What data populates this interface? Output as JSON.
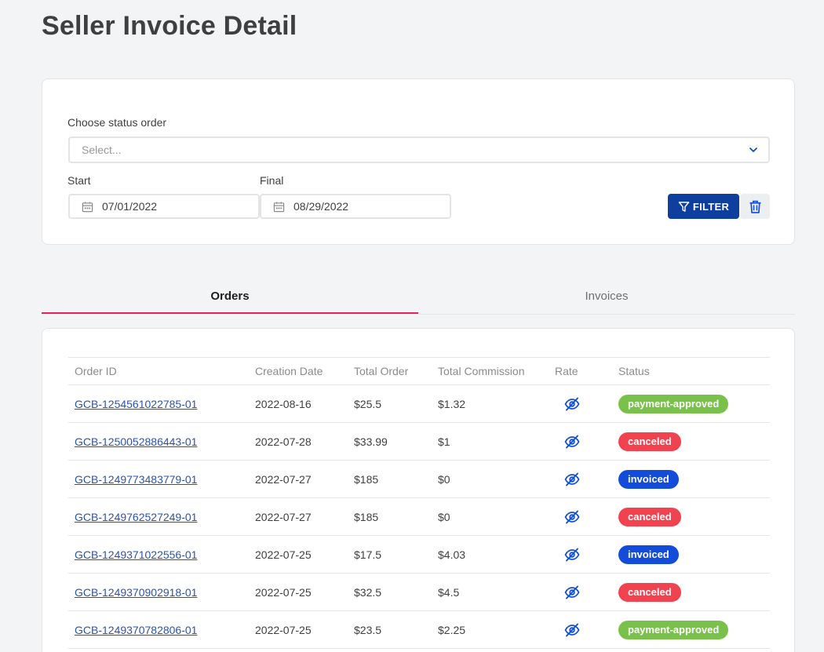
{
  "page": {
    "title": "Seller Invoice Detail"
  },
  "filters": {
    "status_label": "Choose status order",
    "status_placeholder": "Select...",
    "start_label": "Start",
    "start_value": "07/01/2022",
    "final_label": "Final",
    "final_value": "08/29/2022",
    "filter_button": "FILTER",
    "filter_icon": "filter-icon",
    "clear_icon": "trash-icon"
  },
  "tabs": [
    {
      "label": "Orders",
      "active": true
    },
    {
      "label": "Invoices",
      "active": false
    }
  ],
  "table": {
    "columns": [
      "Order ID",
      "Creation Date",
      "Total Order",
      "Total Commission",
      "Rate",
      "Status"
    ],
    "rows": [
      {
        "order_id": "GCB-1254561022785-01",
        "date": "2022-08-16",
        "total": "$25.5",
        "commission": "$1.32",
        "rate_icon": "eye-slash-icon",
        "status": "payment-approved"
      },
      {
        "order_id": "GCB-1250052886443-01",
        "date": "2022-07-28",
        "total": "$33.99",
        "commission": "$1",
        "rate_icon": "eye-slash-icon",
        "status": "canceled"
      },
      {
        "order_id": "GCB-1249773483779-01",
        "date": "2022-07-27",
        "total": "$185",
        "commission": "$0",
        "rate_icon": "eye-slash-icon",
        "status": "invoiced"
      },
      {
        "order_id": "GCB-1249762527249-01",
        "date": "2022-07-27",
        "total": "$185",
        "commission": "$0",
        "rate_icon": "eye-slash-icon",
        "status": "canceled"
      },
      {
        "order_id": "GCB-1249371022556-01",
        "date": "2022-07-25",
        "total": "$17.5",
        "commission": "$4.03",
        "rate_icon": "eye-slash-icon",
        "status": "invoiced"
      },
      {
        "order_id": "GCB-1249370902918-01",
        "date": "2022-07-25",
        "total": "$32.5",
        "commission": "$4.5",
        "rate_icon": "eye-slash-icon",
        "status": "canceled"
      },
      {
        "order_id": "GCB-1249370782806-01",
        "date": "2022-07-25",
        "total": "$23.5",
        "commission": "$2.25",
        "rate_icon": "eye-slash-icon",
        "status": "payment-approved"
      }
    ]
  },
  "colors": {
    "primary": "#0f3f9e",
    "tab_accent": "#e0245e",
    "link": "#2953b2",
    "status_payment_approved": "#79c14a",
    "status_canceled": "#f0434f",
    "status_invoiced": "#134cd8"
  }
}
